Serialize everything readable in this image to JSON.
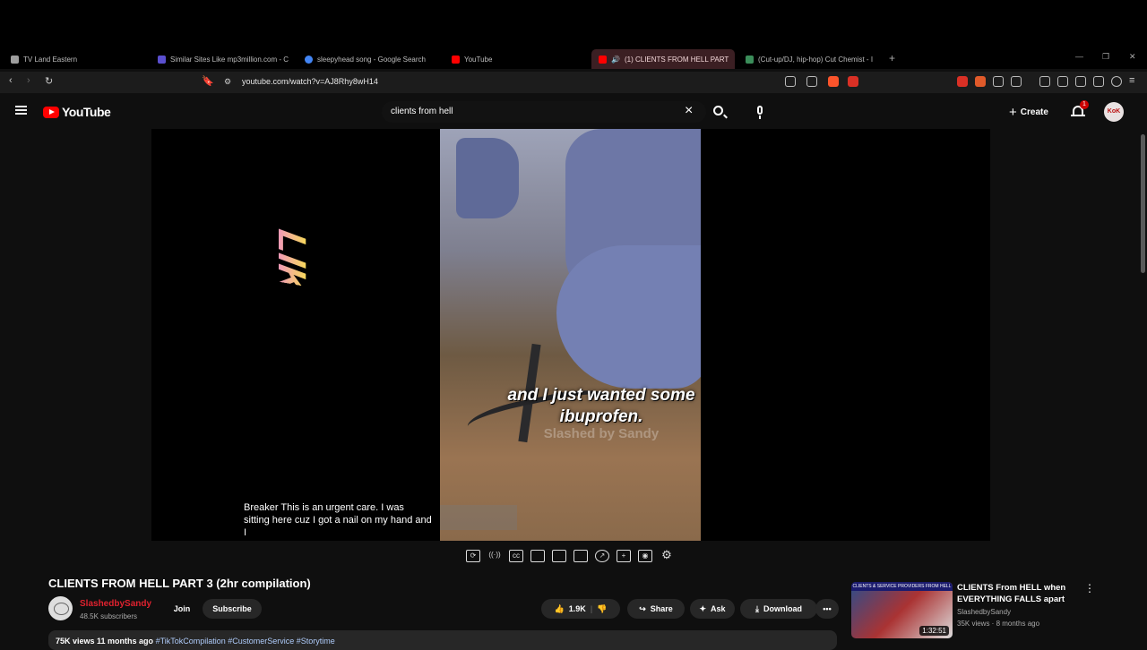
{
  "browser": {
    "tabs": [
      {
        "label": "TV Land Eastern",
        "color": "#9e9e9e"
      },
      {
        "label": "Similar Sites Like mp3million.com - C",
        "color": "#5a4fcf"
      },
      {
        "label": "sleepyhead song - Google Search",
        "color": "#4285f4"
      },
      {
        "label": "YouTube",
        "color": "#ff0000"
      },
      {
        "label": "(1) CLIENTS FROM HELL PART",
        "color": "#ff0000",
        "active": true
      },
      {
        "label": "(Cut-up/DJ, hip-hop) Cut Chemist - I",
        "color": "#3b8d5a"
      }
    ],
    "close_glyph": "×",
    "new_tab": "+",
    "url": "youtube.com/watch?v=AJ8Rhy8wH14",
    "extensions": [
      "#d93025",
      "#ff5500",
      "#888888",
      "#888888",
      "#888888",
      "#888888",
      "#888888",
      "#888888",
      "#888888"
    ]
  },
  "yt": {
    "logo": "YouTube",
    "search_query": "clients from hell",
    "search_clear": "×",
    "create_label": "Create",
    "notification_count": "1",
    "avatar_text": "KoK"
  },
  "video": {
    "caption": "and I just wanted some ibuprofen.",
    "watermark": "Slashed by Sandy",
    "like_art": "LIKE",
    "transcript": "Breaker This is an urgent care. I was sitting here cuz I got a nail on my hand and I"
  },
  "controls": [
    "loop-icon",
    "broadcast-icon",
    "captions-icon",
    "miniplayer-icon",
    "pip-icon",
    "theater-icon",
    "speed-icon",
    "addclip-icon",
    "screenshot-icon",
    "settings-icon"
  ],
  "info": {
    "title": "CLIENTS FROM HELL PART 3 (2hr compilation)",
    "channel": "SlashedbySandy",
    "subscribers": "48.5K subscribers",
    "join": "Join",
    "subscribe": "Subscribe",
    "likes": "1.9K",
    "share": "Share",
    "ask": "Ask",
    "download": "Download",
    "more": "•••",
    "views_date": "75K views  11 months ago",
    "hashtags": "#TikTokCompilation #CustomerService #Storytime"
  },
  "recommended": {
    "title": "CLIENTS From HELL when EVERYTHING FALLS apart",
    "channel": "SlashedbySandy",
    "meta": "35K views · 8 months ago",
    "duration": "1:32:51",
    "thumb_banner": "CLIENTS & SERVICE PROVIDERS FROM HELL"
  }
}
